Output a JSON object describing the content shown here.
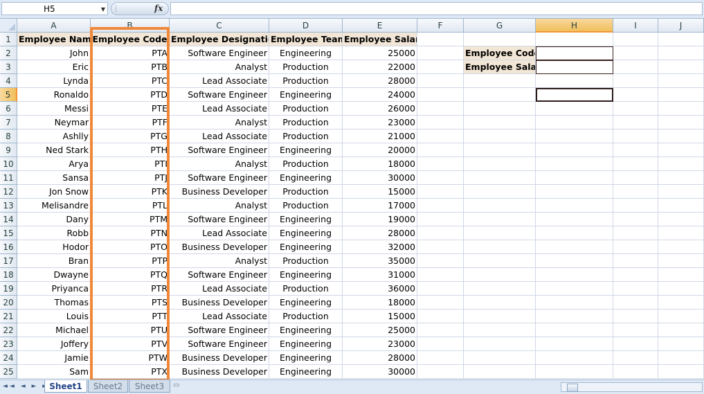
{
  "formula_bar": {
    "name_box": "H5",
    "fx_label": "fx",
    "formula": ""
  },
  "columns": [
    "A",
    "B",
    "C",
    "D",
    "E",
    "F",
    "G",
    "H",
    "I",
    "J"
  ],
  "selected_column": "H",
  "selected_row": "5",
  "table": {
    "headers": [
      "Employee Name",
      "Employee Code",
      "Employee Designation",
      "Employee Team",
      "Employee Salary"
    ],
    "rows": [
      [
        "John",
        "PTA",
        "Software Engineer",
        "Engineering",
        "25000"
      ],
      [
        "Eric",
        "PTB",
        "Analyst",
        "Production",
        "22000"
      ],
      [
        "Lynda",
        "PTC",
        "Lead Associate",
        "Production",
        "28000"
      ],
      [
        "Ronaldo",
        "PTD",
        "Software Engineer",
        "Engineering",
        "24000"
      ],
      [
        "Messi",
        "PTE",
        "Lead Associate",
        "Production",
        "26000"
      ],
      [
        "Neymar",
        "PTF",
        "Analyst",
        "Production",
        "23000"
      ],
      [
        "Ashlly",
        "PTG",
        "Lead Associate",
        "Production",
        "21000"
      ],
      [
        "Ned Stark",
        "PTH",
        "Software Engineer",
        "Engineering",
        "20000"
      ],
      [
        "Arya",
        "PTI",
        "Analyst",
        "Production",
        "18000"
      ],
      [
        "Sansa",
        "PTJ",
        "Software Engineer",
        "Engineering",
        "30000"
      ],
      [
        "Jon Snow",
        "PTK",
        "Business Developer",
        "Production",
        "15000"
      ],
      [
        "Melisandre",
        "PTL",
        "Analyst",
        "Production",
        "17000"
      ],
      [
        "Dany",
        "PTM",
        "Software Engineer",
        "Engineering",
        "19000"
      ],
      [
        "Robb",
        "PTN",
        "Lead Associate",
        "Engineering",
        "28000"
      ],
      [
        "Hodor",
        "PTO",
        "Business Developer",
        "Engineering",
        "32000"
      ],
      [
        "Bran",
        "PTP",
        "Analyst",
        "Production",
        "35000"
      ],
      [
        "Dwayne",
        "PTQ",
        "Software Engineer",
        "Engineering",
        "31000"
      ],
      [
        "Priyanca",
        "PTR",
        "Lead Associate",
        "Production",
        "36000"
      ],
      [
        "Thomas",
        "PTS",
        "Business Developer",
        "Engineering",
        "18000"
      ],
      [
        "Louis",
        "PTT",
        "Lead Associate",
        "Production",
        "15000"
      ],
      [
        "Michael",
        "PTU",
        "Software Engineer",
        "Engineering",
        "25000"
      ],
      [
        "Joffery",
        "PTV",
        "Software Engineer",
        "Engineering",
        "23000"
      ],
      [
        "Jamie",
        "PTW",
        "Business Developer",
        "Engineering",
        "28000"
      ],
      [
        "Sam",
        "PTX",
        "Business Developer",
        "Engineering",
        "30000"
      ]
    ]
  },
  "lookup": {
    "code_label": "Employee Code",
    "salary_label": "Employee Salary",
    "code_value": "",
    "salary_value": ""
  },
  "sheet_tabs": [
    "Sheet1",
    "Sheet2",
    "Sheet3"
  ],
  "active_sheet": "Sheet1",
  "highlight_color": "#f0883a"
}
